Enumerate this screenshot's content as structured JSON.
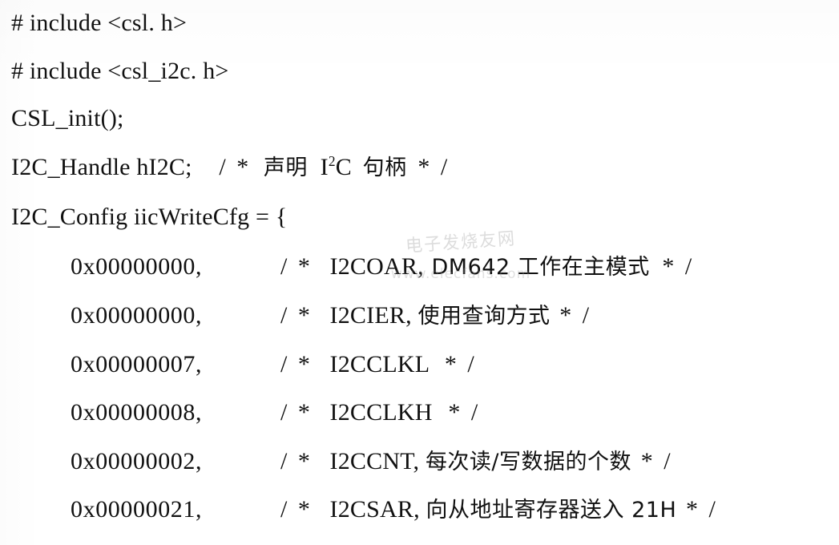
{
  "document": {
    "kind": "scanned-code-listing",
    "language": "C",
    "background_color": "#ffffff",
    "ink_color": "#111111"
  },
  "watermark": {
    "chinese": "电子发烧友网",
    "url": "www.elecfans.com",
    "color": "#9a9a9a"
  },
  "listing": {
    "lines": [
      {
        "id": "include-csl",
        "indent": 0,
        "text": "# include <csl. h>"
      },
      {
        "id": "include-csl-i2c",
        "indent": 0,
        "text": "# include <csl_i2c. h>"
      },
      {
        "id": "csl-init-call",
        "indent": 0,
        "text": "CSL_init();"
      }
    ],
    "handle_line": {
      "id": "i2c-handle-decl",
      "indent": 0,
      "code": "I2C_Handle hI2C;",
      "comment_open": "/ *",
      "comment_cn_before": "声明",
      "comment_symbol_base": "I",
      "comment_symbol_sup": "2",
      "comment_symbol_tail": "C",
      "comment_cn_after": "句柄",
      "comment_close": "* /"
    },
    "config_line": {
      "id": "i2c-config-decl",
      "indent": 0,
      "text": "I2C_Config iicWriteCfg = {"
    },
    "members": [
      {
        "id": "member-i2coar",
        "value": "0x00000000,",
        "comment_open": "/ *",
        "register": "I2COAR,",
        "comment_text": "DM642 工作在主模式",
        "comment_close": "* /"
      },
      {
        "id": "member-i2cier",
        "value": "0x00000000,",
        "comment_open": "/ *",
        "register": "I2CIER,",
        "comment_text": "使用查询方式",
        "comment_close": "* /"
      },
      {
        "id": "member-i2cclkl",
        "value": "0x00000007,",
        "comment_open": "/ *",
        "register": "I2CCLKL",
        "comment_text": "",
        "comment_close": "* /"
      },
      {
        "id": "member-i2cclkh",
        "value": "0x00000008,",
        "comment_open": "/ *",
        "register": "I2CCLKH",
        "comment_text": "",
        "comment_close": "* /"
      },
      {
        "id": "member-i2ccnt",
        "value": "0x00000002,",
        "comment_open": "/ *",
        "register": "I2CCNT,",
        "comment_text": "每次读/写数据的个数",
        "comment_close": "* /"
      },
      {
        "id": "member-i2csar",
        "value": "0x00000021,",
        "comment_open": "/ *",
        "register": "I2CSAR,",
        "comment_text": "向从地址寄存器送入 21H",
        "comment_close": "* /"
      }
    ]
  }
}
